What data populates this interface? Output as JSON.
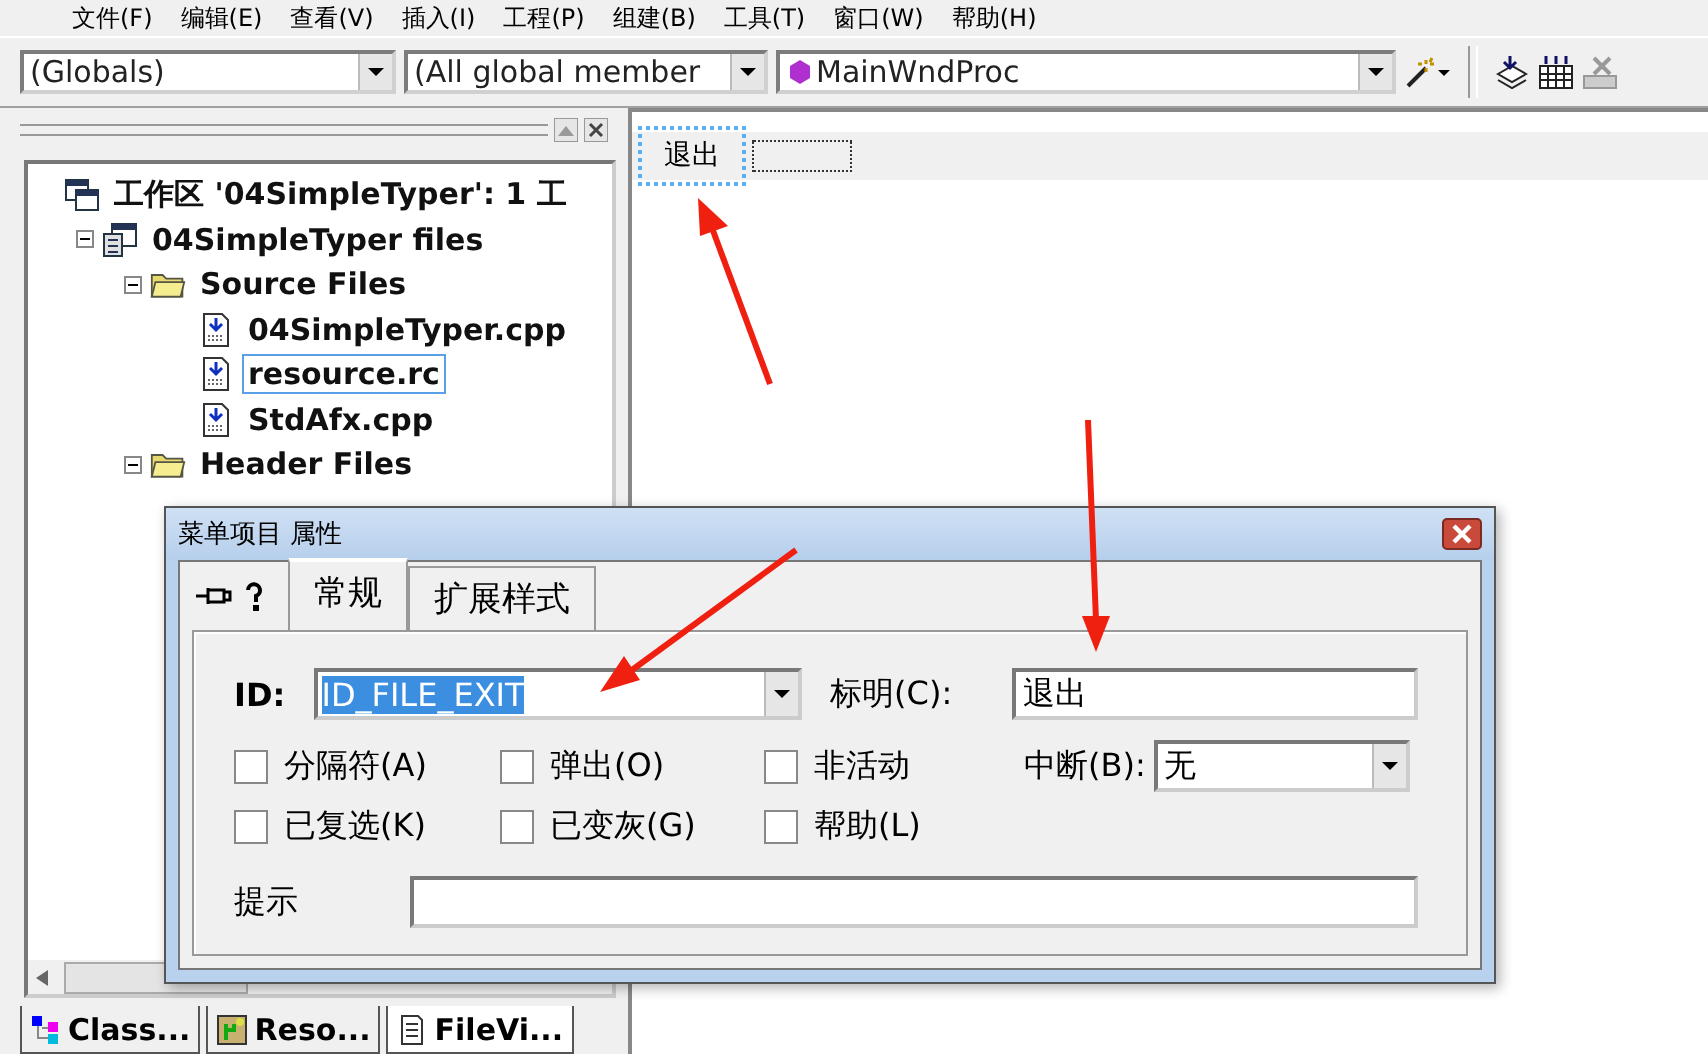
{
  "menu_bar": [
    "文件(F)",
    "编辑(E)",
    "查看(V)",
    "插入(I)",
    "工程(P)",
    "组建(B)",
    "工具(T)",
    "窗口(W)",
    "帮助(H)"
  ],
  "toolbar": {
    "combos": [
      {
        "value": "(Globals)",
        "kind": "plain"
      },
      {
        "value": "(All global member",
        "kind": "plain"
      },
      {
        "value": "MainWndProc",
        "kind": "function"
      }
    ]
  },
  "workspace": {
    "tree": [
      {
        "label": "工作区 '04SimpleTyper': 1 工",
        "kind": "workspace",
        "selected": false,
        "children": [
          {
            "label": "04SimpleTyper files",
            "kind": "project",
            "expanded": true,
            "selected": false,
            "children": [
              {
                "label": "Source Files",
                "kind": "folder",
                "expanded": true,
                "selected": false,
                "children": [
                  {
                    "label": "04SimpleTyper.cpp",
                    "kind": "file",
                    "selected": false
                  },
                  {
                    "label": "resource.rc",
                    "kind": "file",
                    "selected": true
                  },
                  {
                    "label": "StdAfx.cpp",
                    "kind": "file",
                    "selected": false
                  }
                ]
              },
              {
                "label": "Header Files",
                "kind": "folder",
                "expanded": true,
                "selected": false
              }
            ]
          }
        ]
      }
    ],
    "tabs": [
      {
        "label": "Class...",
        "kind": "class",
        "selected": false
      },
      {
        "label": "Reso...",
        "kind": "resource",
        "selected": false
      },
      {
        "label": "FileVi...",
        "kind": "file",
        "selected": true
      }
    ]
  },
  "editor": {
    "menu_items": [
      {
        "label": "退出",
        "selected": true
      }
    ]
  },
  "dialog": {
    "title": "菜单项目 属性",
    "tabs": [
      {
        "label": "常规",
        "selected": true
      },
      {
        "label": "扩展样式",
        "selected": false
      }
    ],
    "id_field": {
      "label": "ID:",
      "value": "ID_FILE_EXIT"
    },
    "caption_field": {
      "label": "标明(C):",
      "value": "退出"
    },
    "checkboxes": [
      {
        "label": "分隔符(A)",
        "checked": false
      },
      {
        "label": "弹出(O)",
        "checked": false
      },
      {
        "label": "非活动",
        "checked": false
      },
      {
        "label": "已复选(K)",
        "checked": false
      },
      {
        "label": "已变灰(G)",
        "checked": false
      },
      {
        "label": "帮助(L)",
        "checked": false
      }
    ],
    "break_field": {
      "label": "中断(B):",
      "value": "无"
    },
    "prompt_field": {
      "label": "提示"
    }
  }
}
